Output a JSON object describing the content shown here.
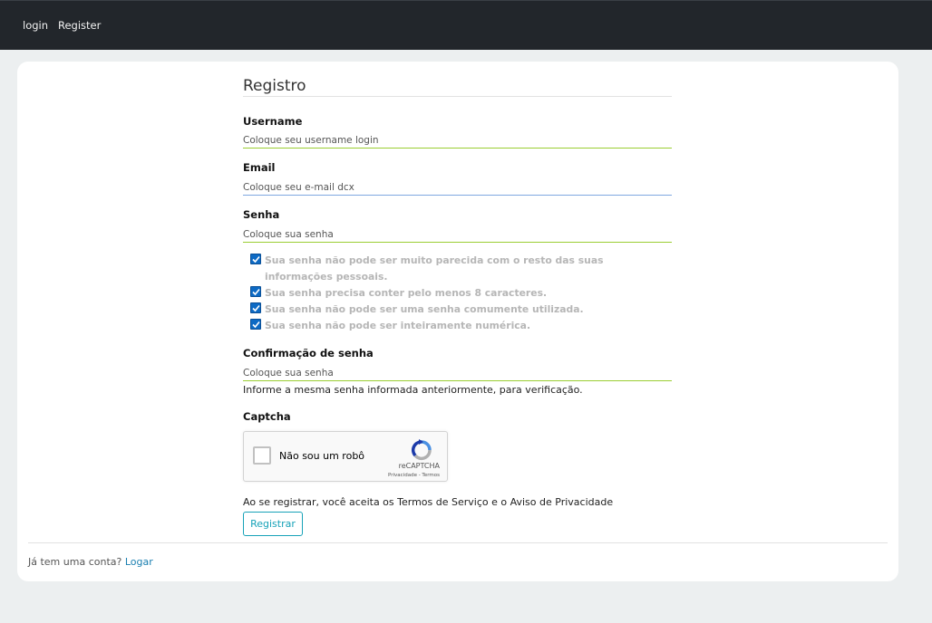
{
  "nav": {
    "login": "login",
    "register": "Register"
  },
  "form": {
    "title": "Registro",
    "username": {
      "label": "Username",
      "placeholder": "Coloque seu username login"
    },
    "email": {
      "label": "Email",
      "placeholder": "Coloque seu e-mail dcx"
    },
    "password": {
      "label": "Senha",
      "placeholder": "Coloque sua senha",
      "rules": [
        "Sua senha não pode ser muito parecida com o resto das suas informações pessoais.",
        "Sua senha precisa conter pelo menos 8 caracteres.",
        "Sua senha não pode ser uma senha comumente utilizada.",
        "Sua senha não pode ser inteiramente numérica."
      ]
    },
    "confirm": {
      "label": "Confirmação de senha",
      "placeholder": "Coloque sua senha",
      "help": "Informe a mesma senha informada anteriormente, para verificação."
    },
    "captcha": {
      "label": "Captcha",
      "checkbox_label": "Não sou um robô",
      "brand": "reCAPTCHA",
      "links": "Privacidade - Termos"
    },
    "terms": "Ao se registrar, você aceita os Termos de Serviço e o Aviso de Privacidade",
    "submit": "Registrar"
  },
  "footer": {
    "prompt": "Já tem uma conta?",
    "link": "Logar"
  },
  "colors": {
    "navbar": "#22262b",
    "page_bg": "#eceff0",
    "accent": "#17a2b8",
    "valid_underline": "#9acd32",
    "checkbox": "#0d6ac4"
  }
}
